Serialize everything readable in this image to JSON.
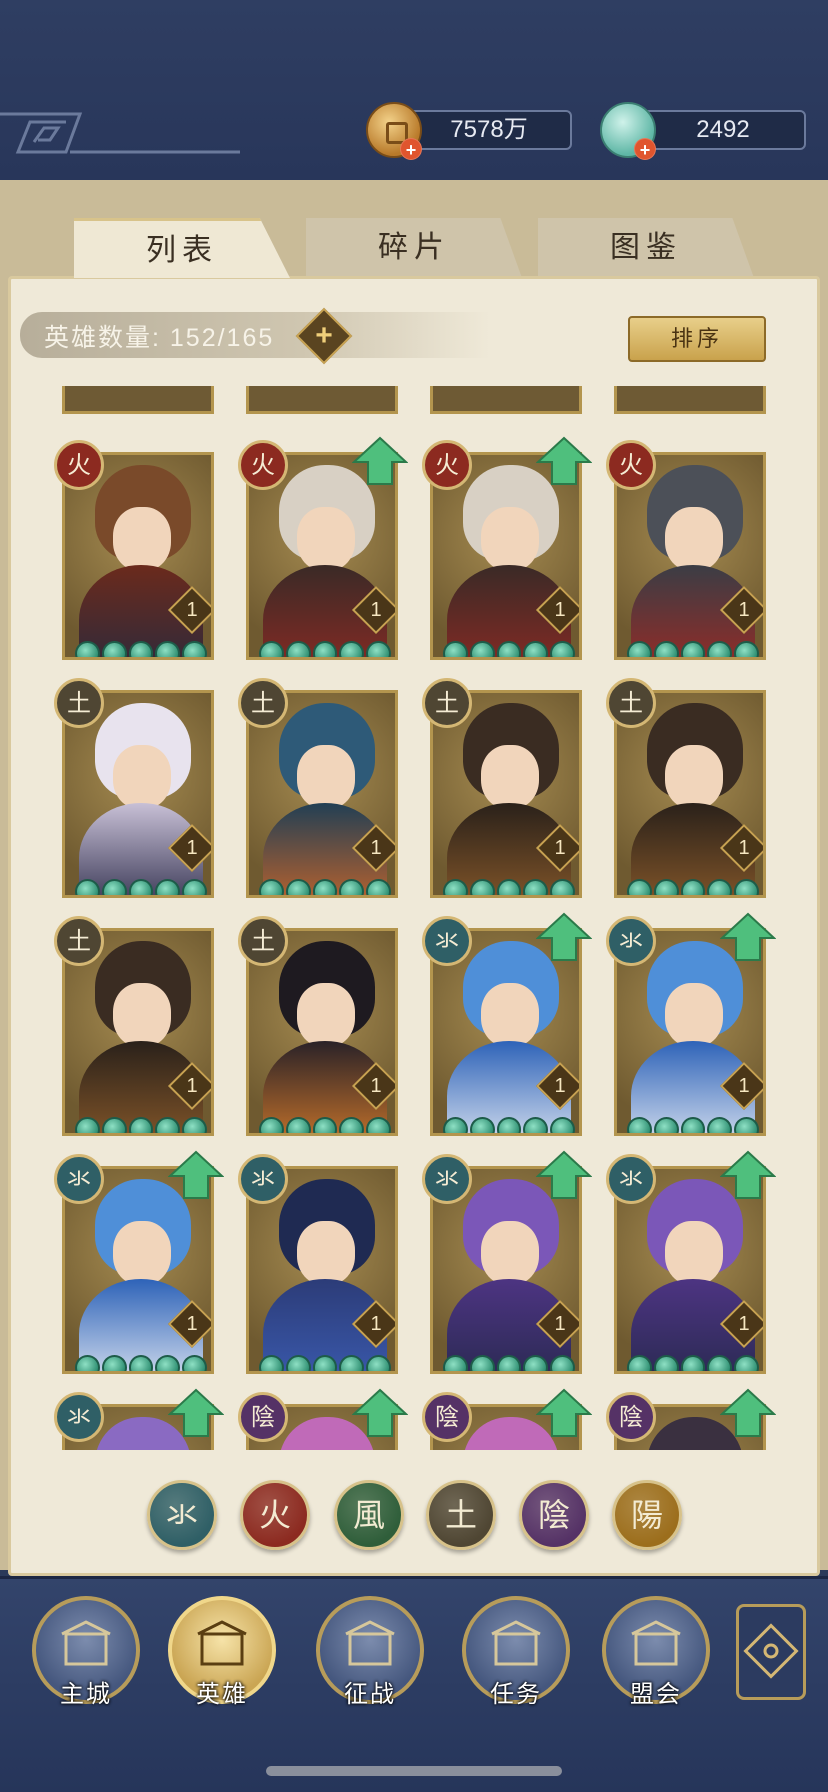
{
  "currencies": {
    "coin": {
      "icon": "copper-coin-icon",
      "value": "7578万",
      "add": "+"
    },
    "jade": {
      "icon": "jade-shell-icon",
      "value": "2492",
      "add": "+"
    }
  },
  "tabs": [
    {
      "label": "列表",
      "active": true
    },
    {
      "label": "碎片",
      "active": false
    },
    {
      "label": "图鉴",
      "active": false
    }
  ],
  "hero_count": {
    "label": "英雄数量: 152/165",
    "add": "+"
  },
  "sort_button": "排序",
  "elements": {
    "water": {
      "glyph": "氺",
      "color": "#2f5f66"
    },
    "fire": {
      "glyph": "火",
      "color": "#8c2a20"
    },
    "wind": {
      "glyph": "風",
      "color": "#2f5e3a"
    },
    "earth": {
      "glyph": "土",
      "color": "#4f4633"
    },
    "yin": {
      "glyph": "陰",
      "color": "#553266"
    },
    "yang": {
      "glyph": "陽",
      "color": "#9c6e1c"
    }
  },
  "heroes": [
    {
      "element": "fire",
      "level": "1",
      "stars": 5,
      "upgradable": false,
      "palette": [
        "#7a4a2a",
        "#6b2a1c",
        "#2b2a3d"
      ]
    },
    {
      "element": "fire",
      "level": "1",
      "stars": 5,
      "upgradable": true,
      "palette": [
        "#d8d0c4",
        "#3a2a26",
        "#8a2a24"
      ]
    },
    {
      "element": "fire",
      "level": "1",
      "stars": 5,
      "upgradable": true,
      "palette": [
        "#d8d0c4",
        "#3a2a26",
        "#8a2a24"
      ]
    },
    {
      "element": "fire",
      "level": "1",
      "stars": 5,
      "upgradable": false,
      "palette": [
        "#4c5058",
        "#3b3d45",
        "#9a2a24"
      ]
    },
    {
      "element": "earth",
      "level": "1",
      "stars": 5,
      "upgradable": false,
      "palette": [
        "#e8e3ee",
        "#c8c0d6",
        "#2d2c4a"
      ]
    },
    {
      "element": "earth",
      "level": "1",
      "stars": 5,
      "upgradable": false,
      "palette": [
        "#2e5a78",
        "#223f54",
        "#c8662a"
      ]
    },
    {
      "element": "earth",
      "level": "1",
      "stars": 5,
      "upgradable": false,
      "palette": [
        "#3a2c22",
        "#2a211a",
        "#8a5a2a"
      ]
    },
    {
      "element": "earth",
      "level": "1",
      "stars": 5,
      "upgradable": false,
      "palette": [
        "#3a2c22",
        "#2a211a",
        "#8a5a2a"
      ]
    },
    {
      "element": "earth",
      "level": "1",
      "stars": 5,
      "upgradable": false,
      "palette": [
        "#3a2c22",
        "#2a211a",
        "#8a5a2a"
      ]
    },
    {
      "element": "earth",
      "level": "1",
      "stars": 5,
      "upgradable": false,
      "palette": [
        "#1e1a20",
        "#2a2228",
        "#d0782a"
      ]
    },
    {
      "element": "water",
      "level": "1",
      "stars": 5,
      "upgradable": true,
      "palette": [
        "#4f8fd8",
        "#2e63b8",
        "#dfe6f2"
      ]
    },
    {
      "element": "water",
      "level": "1",
      "stars": 5,
      "upgradable": true,
      "palette": [
        "#4f8fd8",
        "#2e63b8",
        "#dfe6f2"
      ]
    },
    {
      "element": "water",
      "level": "1",
      "stars": 5,
      "upgradable": true,
      "palette": [
        "#4f8fd8",
        "#2e63b8",
        "#dfe6f2"
      ]
    },
    {
      "element": "water",
      "level": "1",
      "stars": 5,
      "upgradable": false,
      "palette": [
        "#1f2a52",
        "#2c3c78",
        "#3b5bb0"
      ]
    },
    {
      "element": "water",
      "level": "1",
      "stars": 5,
      "upgradable": true,
      "palette": [
        "#7b57b8",
        "#4d3482",
        "#27294e"
      ]
    },
    {
      "element": "water",
      "level": "1",
      "stars": 5,
      "upgradable": true,
      "palette": [
        "#7b57b8",
        "#4d3482",
        "#27294e"
      ]
    },
    {
      "element": "water",
      "level": "",
      "stars": 0,
      "upgradable": true,
      "palette": [
        "#8a6ac2",
        "#6a4a9a",
        "#8a7344"
      ]
    },
    {
      "element": "yin",
      "level": "",
      "stars": 0,
      "upgradable": true,
      "palette": [
        "#c06ab8",
        "#8a3a8a",
        "#8a7344"
      ]
    },
    {
      "element": "yin",
      "level": "",
      "stars": 0,
      "upgradable": true,
      "palette": [
        "#c06ab8",
        "#8a3a8a",
        "#8a7344"
      ]
    },
    {
      "element": "yin",
      "level": "",
      "stars": 0,
      "upgradable": true,
      "palette": [
        "#3a3040",
        "#2a2430",
        "#8a7344"
      ]
    }
  ],
  "filters": [
    "water",
    "fire",
    "wind",
    "earth",
    "yin",
    "yang"
  ],
  "nav": [
    {
      "label": "主城",
      "icon": "city-gate-icon",
      "active": false
    },
    {
      "label": "英雄",
      "icon": "hero-portrait-icon",
      "active": true
    },
    {
      "label": "征战",
      "icon": "battle-banner-icon",
      "active": false
    },
    {
      "label": "任务",
      "icon": "scroll-task-icon",
      "active": false
    },
    {
      "label": "盟会",
      "icon": "alliance-hall-icon",
      "active": false
    }
  ],
  "menu_icon": "lattice-menu-icon"
}
